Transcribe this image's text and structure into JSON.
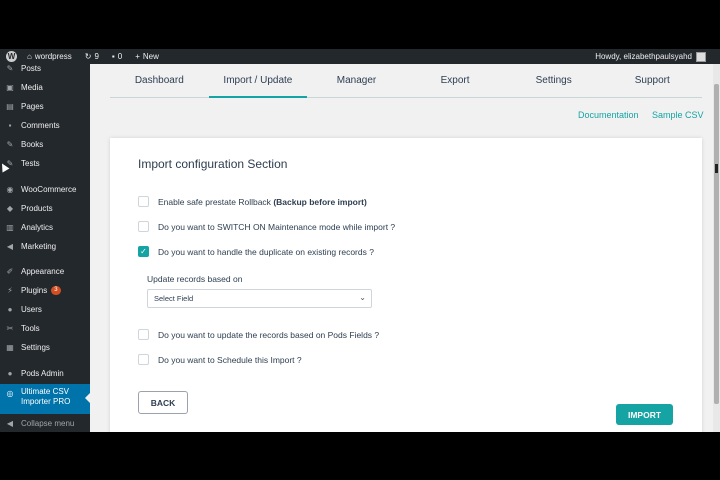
{
  "adminbar": {
    "site_name": "wordpress",
    "updates_count": "9",
    "comments_count": "0",
    "new_label": "New",
    "howdy": "Howdy, elizabethpaulsyahd"
  },
  "sidebar": {
    "items": [
      {
        "label": "Posts",
        "icon": "pin-icon"
      },
      {
        "label": "Media",
        "icon": "media-icon"
      },
      {
        "label": "Pages",
        "icon": "pages-icon"
      },
      {
        "label": "Comments",
        "icon": "comments-icon"
      },
      {
        "label": "Books",
        "icon": "pin-icon"
      },
      {
        "label": "Tests",
        "icon": "pin-icon"
      },
      {
        "label": "WooCommerce",
        "icon": "woocommerce-icon"
      },
      {
        "label": "Products",
        "icon": "products-icon"
      },
      {
        "label": "Analytics",
        "icon": "analytics-icon"
      },
      {
        "label": "Marketing",
        "icon": "megaphone-icon"
      },
      {
        "label": "Appearance",
        "icon": "brush-icon"
      },
      {
        "label": "Plugins",
        "icon": "plugin-icon",
        "badge": "3"
      },
      {
        "label": "Users",
        "icon": "users-icon"
      },
      {
        "label": "Tools",
        "icon": "wrench-icon"
      },
      {
        "label": "Settings",
        "icon": "settings-icon"
      },
      {
        "label": "Pods Admin",
        "icon": "pods-icon"
      },
      {
        "label": "Ultimate CSV Importer PRO",
        "icon": "csv-importer-icon"
      },
      {
        "label": "Collapse menu",
        "icon": "collapse-icon"
      }
    ]
  },
  "tabs": [
    "Dashboard",
    "Import / Update",
    "Manager",
    "Export",
    "Settings",
    "Support"
  ],
  "links": {
    "documentation": "Documentation",
    "sample_csv": "Sample CSV"
  },
  "card": {
    "title": "Import configuration Section",
    "opt1_text": "Enable safe prestate Rollback",
    "opt1_bold": "(Backup before import)",
    "opt2": "Do you want to SWITCH ON Maintenance mode while import ?",
    "opt3": "Do you want to handle the duplicate on existing records ?",
    "update_based_on_label": "Update records based on",
    "select_value": "Select Field",
    "opt4": "Do you want to update the records based on Pods Fields ?",
    "opt5": "Do you want to Schedule this Import ?",
    "back_label": "BACK",
    "import_label": "IMPORT"
  },
  "state": {
    "active_tab": "Import / Update",
    "opt3_checked": true
  },
  "colors": {
    "accent": "#15a3a3",
    "admin_dark": "#23282d",
    "admin_current": "#0073aa"
  }
}
